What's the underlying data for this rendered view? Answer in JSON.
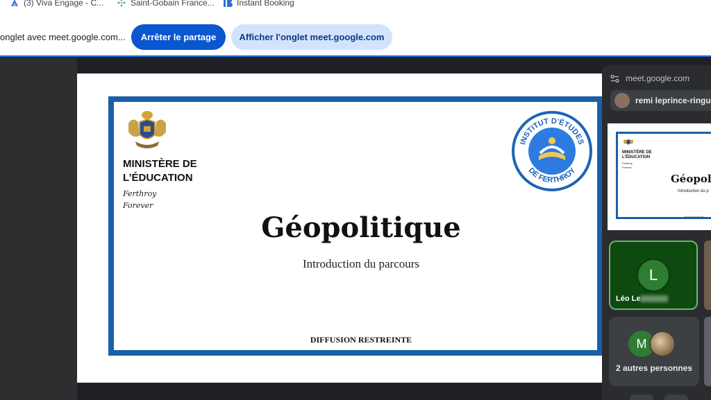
{
  "bookmarks": [
    {
      "label": "(3) Viva Engage - C...",
      "icon": "viva-engage-icon"
    },
    {
      "label": "Saint-Gobain France...",
      "icon": "saint-gobain-icon"
    },
    {
      "label": "Instant Booking",
      "icon": "instant-booking-icon"
    }
  ],
  "sharebar": {
    "text": "onglet avec meet.google.com...",
    "stop_label": "Arrêter le partage",
    "show_label": "Afficher l'onglet meet.google.com"
  },
  "slide": {
    "ministry": [
      "MINISTÈRE DE",
      "L’ÉDUCATION"
    ],
    "motto": [
      "Ferthroy",
      "Forever"
    ],
    "seal_text_top": "INSTITUT D'ÉTUDES",
    "seal_text_bottom": "DE FERTHROY",
    "title": "Géopolitique",
    "subtitle": "Introduction du parcours",
    "footer": "DIFFUSION RESTREINTE"
  },
  "panel": {
    "url": "meet.google.com",
    "presenter": "remi leprince-ringu",
    "thumb": {
      "ministry": [
        "MINISTÈRE DE",
        "L’ÉDUCATION"
      ],
      "motto": [
        "Ferthroy",
        "Forever"
      ],
      "title": "Géopolit",
      "subtitle": "Introduction du p",
      "footer": "DIFFUSION RESTR"
    },
    "tile_leo": {
      "initial": "L",
      "name": "Léo Le"
    },
    "tile_others": {
      "initial": "M",
      "label": "2 autres personnes"
    }
  },
  "colors": {
    "accent": "#0b57d0",
    "frame": "#1a5fa8",
    "leo_tile": "#0e4a0f",
    "leo_border": "#66bb6a"
  }
}
